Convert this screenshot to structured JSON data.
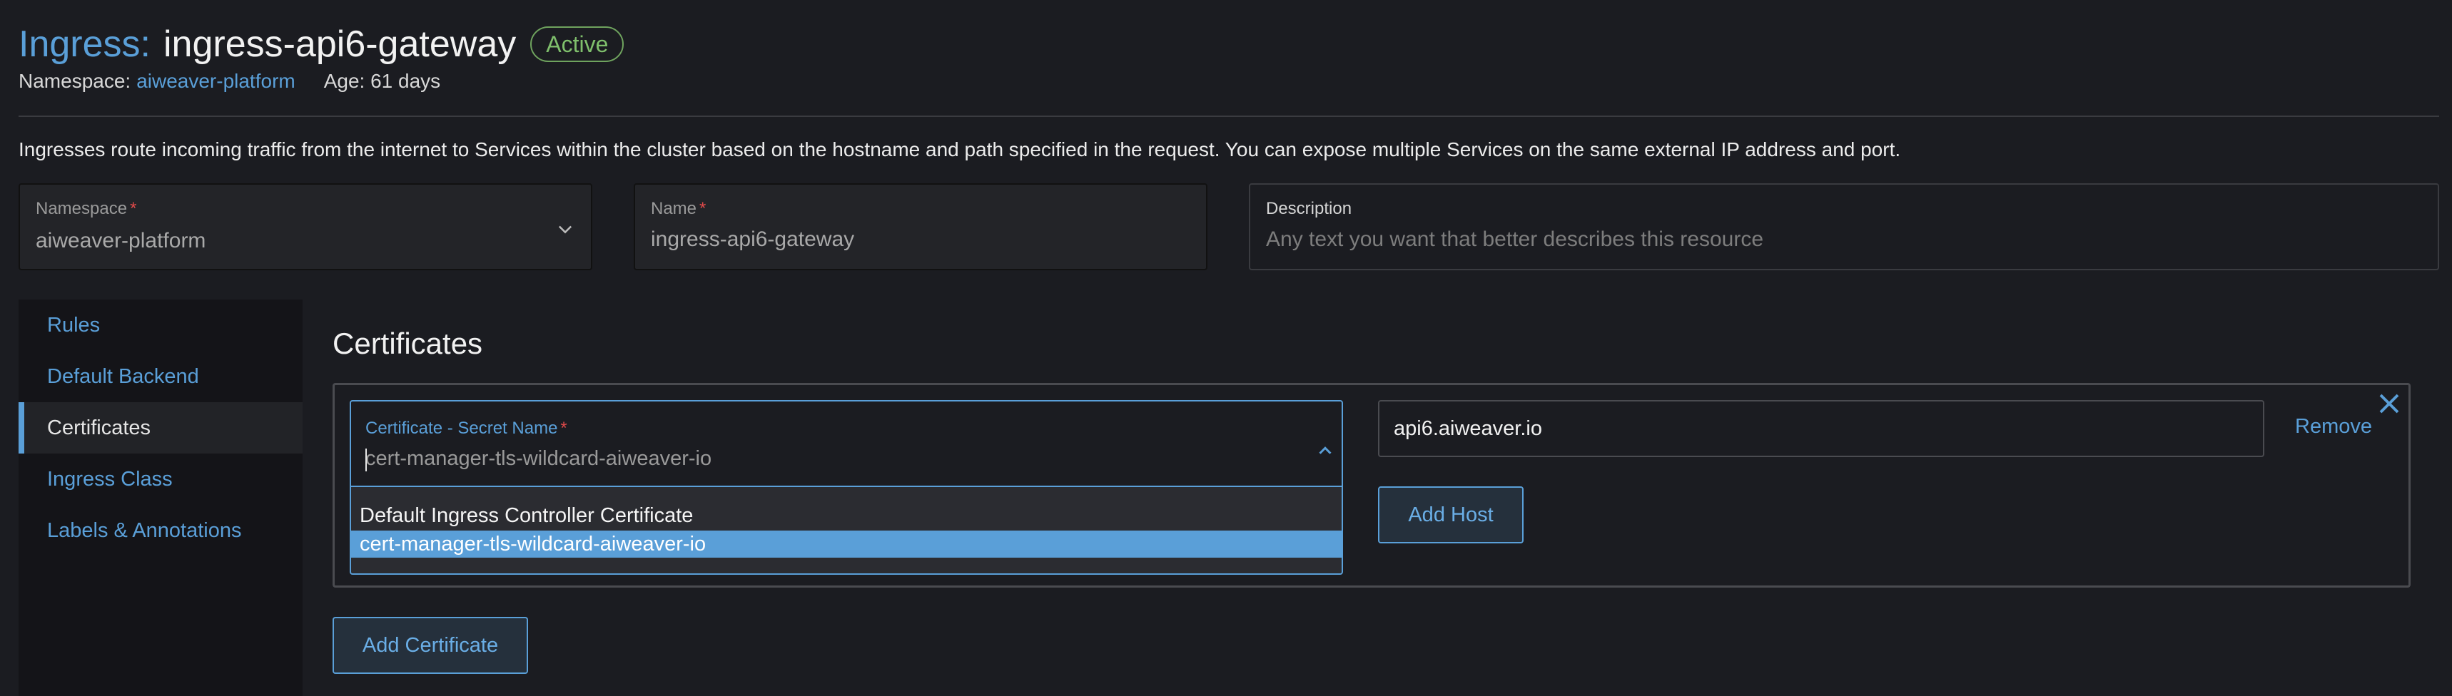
{
  "header": {
    "kind_label": "Ingress:",
    "name": "ingress-api6-gateway",
    "status": "Active",
    "namespace_label": "Namespace:",
    "namespace_value": "aiweaver-platform",
    "age": "Age: 61 days"
  },
  "description_text": "Ingresses route incoming traffic from the internet to Services within the cluster based on the hostname and path specified in the request. You can expose multiple Services on the same external IP address and port.",
  "fields": {
    "namespace": {
      "label": "Namespace",
      "value": "aiweaver-platform",
      "required": "*"
    },
    "name": {
      "label": "Name",
      "value": "ingress-api6-gateway",
      "required": "*"
    },
    "description": {
      "label": "Description",
      "placeholder": "Any text you want that better describes this resource"
    }
  },
  "nav": {
    "items": [
      {
        "label": "Rules"
      },
      {
        "label": "Default Backend"
      },
      {
        "label": "Certificates"
      },
      {
        "label": "Ingress Class"
      },
      {
        "label": "Labels & Annotations"
      }
    ]
  },
  "certificates": {
    "section_title": "Certificates",
    "secret_label": "Certificate - Secret Name",
    "secret_required": "*",
    "secret_value": "cert-manager-tls-wildcard-aiweaver-io",
    "options": [
      "Default Ingress Controller Certificate",
      "cert-manager-tls-wildcard-aiweaver-io"
    ],
    "host_value": "api6.aiweaver.io",
    "remove_label": "Remove",
    "add_host_label": "Add Host",
    "add_certificate_label": "Add Certificate"
  },
  "colors": {
    "accent": "#5a9fd8",
    "background": "#1b1c21",
    "status_green": "#7fbf6c",
    "required_red": "#e04a4a"
  }
}
